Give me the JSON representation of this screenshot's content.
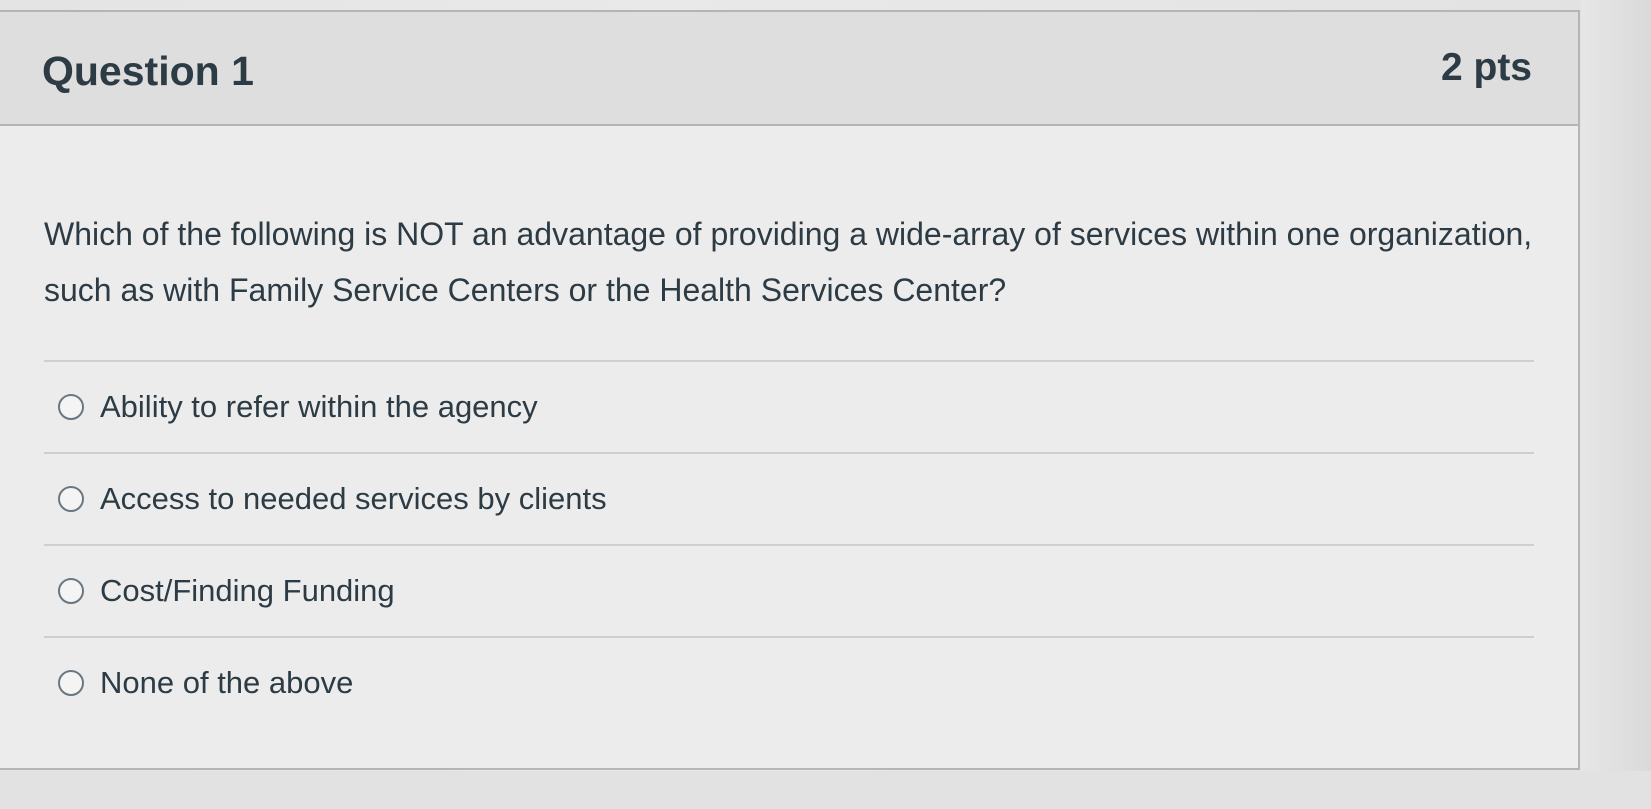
{
  "question": {
    "title": "Question 1",
    "points": "2 pts",
    "text": "Which of the following is NOT an advantage of providing a wide-array of services within one organization, such as with Family Service Centers or the Health Services Center?",
    "answers": [
      {
        "label": "Ability to refer within the agency",
        "selected": false
      },
      {
        "label": "Access to needed services by clients",
        "selected": false
      },
      {
        "label": "Cost/Finding Funding",
        "selected": false
      },
      {
        "label": "None of the above",
        "selected": false
      }
    ]
  },
  "colors": {
    "text": "#2d3b45",
    "header_bg": "#dedede",
    "border": "#b5b5b5"
  }
}
